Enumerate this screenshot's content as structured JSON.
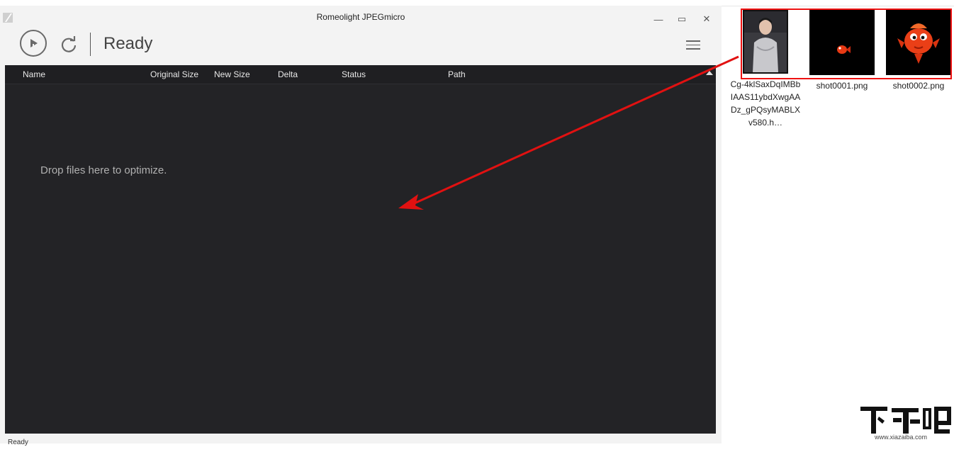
{
  "window": {
    "title": "Romeolight JPEGmicro",
    "minimize_glyph": "—",
    "maximize_glyph": "▭",
    "close_glyph": "✕"
  },
  "toolbar": {
    "status": "Ready"
  },
  "list": {
    "columns": [
      "Name",
      "Original Size",
      "New Size",
      "Delta",
      "Status",
      "Path"
    ],
    "drop_hint": "Drop files here to optimize."
  },
  "statusbar": {
    "text": "Ready"
  },
  "desktop": {
    "files": [
      {
        "name": "Cg-4klSaxDqIMBbIAAS11ybdXwgAADz_gPQsyMABLXv580.h…",
        "icon": "photo-thumbnail"
      },
      {
        "name": "shot0001.png",
        "icon": "goldfish-small-thumbnail"
      },
      {
        "name": "shot0002.png",
        "icon": "goldfish-large-thumbnail"
      }
    ]
  },
  "watermark": {
    "domain": "www.xiazaiba.com"
  },
  "colors": {
    "list_bg": "#232326",
    "accent_red": "#e11111",
    "window_bg": "#f3f3f3"
  }
}
